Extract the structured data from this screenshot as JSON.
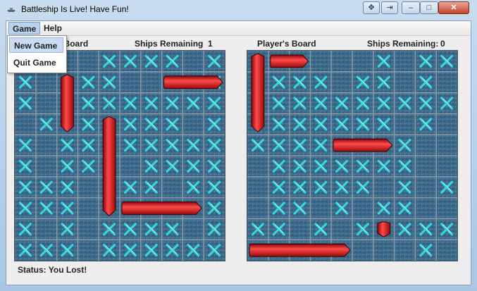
{
  "window": {
    "title": "Battleship Is Live! Have Fun!"
  },
  "menubar": {
    "game": "Game",
    "help": "Help"
  },
  "game_menu": {
    "items": [
      "New Game",
      "Quit Game"
    ]
  },
  "computer_board": {
    "title": "Computer's Board",
    "ships_label": "Ships Remaining",
    "ships_remaining": "1",
    "hits": [
      [
        0,
        0
      ],
      [
        4,
        0
      ],
      [
        5,
        0
      ],
      [
        6,
        0
      ],
      [
        7,
        0
      ],
      [
        9,
        0
      ],
      [
        0,
        1
      ],
      [
        3,
        1
      ],
      [
        4,
        1
      ],
      [
        9,
        1
      ],
      [
        0,
        2
      ],
      [
        3,
        2
      ],
      [
        4,
        2
      ],
      [
        5,
        2
      ],
      [
        6,
        2
      ],
      [
        7,
        2
      ],
      [
        8,
        2
      ],
      [
        9,
        2
      ],
      [
        1,
        3
      ],
      [
        3,
        3
      ],
      [
        5,
        3
      ],
      [
        6,
        3
      ],
      [
        7,
        3
      ],
      [
        9,
        3
      ],
      [
        0,
        4
      ],
      [
        2,
        4
      ],
      [
        3,
        4
      ],
      [
        5,
        4
      ],
      [
        6,
        4
      ],
      [
        7,
        4
      ],
      [
        8,
        4
      ],
      [
        9,
        4
      ],
      [
        0,
        5
      ],
      [
        2,
        5
      ],
      [
        3,
        5
      ],
      [
        6,
        5
      ],
      [
        7,
        5
      ],
      [
        8,
        5
      ],
      [
        9,
        5
      ],
      [
        0,
        6
      ],
      [
        1,
        6
      ],
      [
        2,
        6
      ],
      [
        5,
        6
      ],
      [
        6,
        6
      ],
      [
        8,
        6
      ],
      [
        9,
        6
      ],
      [
        0,
        7
      ],
      [
        1,
        7
      ],
      [
        2,
        7
      ],
      [
        9,
        7
      ],
      [
        0,
        8
      ],
      [
        2,
        8
      ],
      [
        4,
        8
      ],
      [
        5,
        8
      ],
      [
        6,
        8
      ],
      [
        7,
        8
      ],
      [
        9,
        8
      ],
      [
        0,
        9
      ],
      [
        1,
        9
      ],
      [
        2,
        9
      ],
      [
        4,
        9
      ],
      [
        5,
        9
      ],
      [
        6,
        9
      ],
      [
        7,
        9
      ],
      [
        8,
        9
      ],
      [
        9,
        9
      ]
    ],
    "ships": [
      [
        7,
        1,
        9,
        1
      ],
      [
        2,
        1,
        2,
        3
      ],
      [
        4,
        3,
        4,
        7
      ],
      [
        5,
        7,
        8,
        7
      ]
    ]
  },
  "player_board": {
    "title": "Player's Board",
    "ships_label": "Ships Remaining:",
    "ships_remaining": "0",
    "hits": [
      [
        6,
        0
      ],
      [
        8,
        0
      ],
      [
        9,
        0
      ],
      [
        1,
        1
      ],
      [
        2,
        1
      ],
      [
        3,
        1
      ],
      [
        5,
        1
      ],
      [
        6,
        1
      ],
      [
        8,
        1
      ],
      [
        1,
        2
      ],
      [
        2,
        2
      ],
      [
        3,
        2
      ],
      [
        4,
        2
      ],
      [
        5,
        2
      ],
      [
        6,
        2
      ],
      [
        7,
        2
      ],
      [
        8,
        2
      ],
      [
        9,
        2
      ],
      [
        1,
        3
      ],
      [
        2,
        3
      ],
      [
        3,
        3
      ],
      [
        4,
        3
      ],
      [
        5,
        3
      ],
      [
        6,
        3
      ],
      [
        8,
        3
      ],
      [
        0,
        4
      ],
      [
        1,
        4
      ],
      [
        2,
        4
      ],
      [
        3,
        4
      ],
      [
        7,
        4
      ],
      [
        1,
        5
      ],
      [
        2,
        5
      ],
      [
        3,
        5
      ],
      [
        4,
        5
      ],
      [
        5,
        5
      ],
      [
        6,
        5
      ],
      [
        7,
        5
      ],
      [
        1,
        6
      ],
      [
        2,
        6
      ],
      [
        3,
        6
      ],
      [
        4,
        6
      ],
      [
        5,
        6
      ],
      [
        7,
        6
      ],
      [
        9,
        6
      ],
      [
        1,
        7
      ],
      [
        2,
        7
      ],
      [
        4,
        7
      ],
      [
        6,
        7
      ],
      [
        7,
        7
      ],
      [
        0,
        8
      ],
      [
        1,
        8
      ],
      [
        3,
        8
      ],
      [
        5,
        8
      ],
      [
        7,
        8
      ],
      [
        8,
        8
      ],
      [
        9,
        8
      ],
      [
        8,
        9
      ]
    ],
    "ships": [
      [
        0,
        0,
        0,
        3
      ],
      [
        1,
        0,
        2,
        0
      ],
      [
        4,
        4,
        6,
        4
      ],
      [
        6,
        8,
        6,
        8
      ],
      [
        0,
        9,
        4,
        9
      ]
    ]
  },
  "status": "Status: You Lost!",
  "colors": {
    "water": "#3b6888",
    "hit_mark": "#35d6de",
    "ship": "#e0121a"
  }
}
